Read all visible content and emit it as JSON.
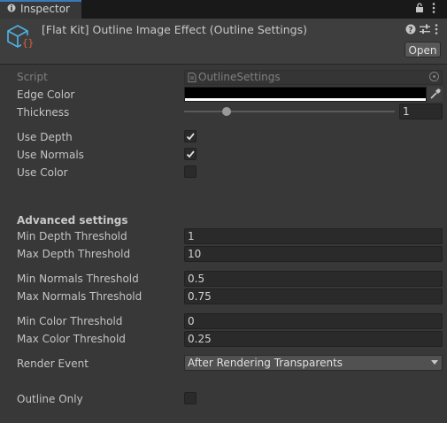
{
  "tab": {
    "label": "Inspector"
  },
  "component": {
    "title": "[Flat Kit] Outline Image Effect (Outline Settings)",
    "open_label": "Open"
  },
  "script": {
    "label": "Script",
    "value": "OutlineSettings"
  },
  "edge_color": {
    "label": "Edge Color",
    "value": "#000000"
  },
  "thickness": {
    "label": "Thickness",
    "value": "1",
    "slider_fraction": 0.2
  },
  "use_depth": {
    "label": "Use Depth",
    "checked": true
  },
  "use_normals": {
    "label": "Use Normals",
    "checked": true
  },
  "use_color": {
    "label": "Use Color",
    "checked": false
  },
  "advanced": {
    "heading": "Advanced settings"
  },
  "fields": {
    "min_depth": {
      "label": "Min Depth Threshold",
      "value": "1"
    },
    "max_depth": {
      "label": "Max Depth Threshold",
      "value": "10"
    },
    "min_normals": {
      "label": "Min Normals Threshold",
      "value": "0.5"
    },
    "max_normals": {
      "label": "Max Normals Threshold",
      "value": "0.75"
    },
    "min_color": {
      "label": "Min Color Threshold",
      "value": "0"
    },
    "max_color": {
      "label": "Max Color Threshold",
      "value": "0.25"
    }
  },
  "render_event": {
    "label": "Render Event",
    "value": "After Rendering Transparents"
  },
  "outline_only": {
    "label": "Outline Only",
    "checked": false
  },
  "colors": {
    "accent": "#3a79bb",
    "icon_blue": "#4fb3e8",
    "icon_red": "#e0603a"
  }
}
